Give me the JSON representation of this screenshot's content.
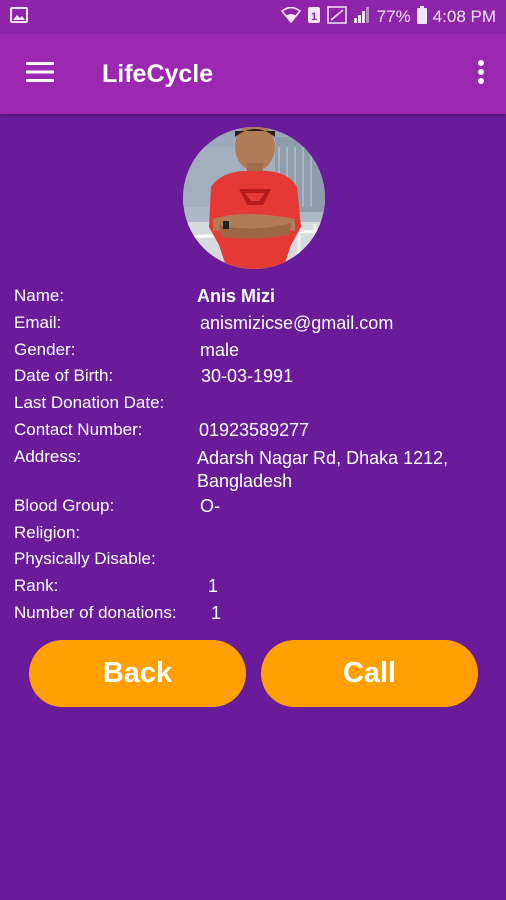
{
  "status_bar": {
    "battery": "77%",
    "time": "4:08 PM"
  },
  "app_bar": {
    "title": "LifeCycle"
  },
  "profile": {
    "fields": [
      {
        "label": "Name:",
        "value": "Anis Mizi"
      },
      {
        "label": "Email:",
        "value": "anismizicse@gmail.com"
      },
      {
        "label": "Gender:",
        "value": "male"
      },
      {
        "label": "Date of Birth:",
        "value": "30-03-1991"
      },
      {
        "label": "Last Donation Date:",
        "value": ""
      },
      {
        "label": "Contact Number:",
        "value": "01923589277"
      },
      {
        "label": "Address:",
        "value": "Adarsh Nagar Rd, Dhaka 1212, Bangladesh"
      },
      {
        "label": "Blood Group:",
        "value": "O-"
      },
      {
        "label": "Religion:",
        "value": ""
      },
      {
        "label": "Physically Disable:",
        "value": ""
      },
      {
        "label": "Rank:",
        "value": "1"
      },
      {
        "label": "Number of donations:",
        "value": "1"
      }
    ]
  },
  "actions": {
    "back_label": "Back",
    "call_label": "Call"
  },
  "colors": {
    "background": "#6a1b9a",
    "app_bar": "#9c27b0",
    "button": "#ffa000"
  }
}
